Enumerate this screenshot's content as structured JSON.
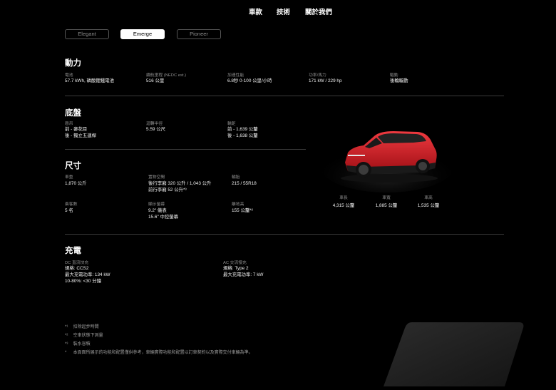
{
  "nav": {
    "items": [
      {
        "label": "車款"
      },
      {
        "label": "技術"
      },
      {
        "label": "關於我們"
      }
    ]
  },
  "trims": {
    "options": [
      {
        "label": "Elegant"
      },
      {
        "label": "Emerge"
      },
      {
        "label": "Pioneer"
      }
    ],
    "selected": "Emerge"
  },
  "power": {
    "title": "動力",
    "specs": [
      {
        "label": "電池",
        "value": "57.7 kWh, 磷酸鋰鐵電池"
      },
      {
        "label": "續航里程 (NEDC est.)",
        "value": "516 公里"
      },
      {
        "label": "加速性能",
        "value": "6.8秒 0-100 公里/小時"
      },
      {
        "label": "功率/馬力",
        "value": "171 kW / 229 hp"
      },
      {
        "label": "驅動",
        "value": "後輪驅動"
      }
    ]
  },
  "chassis": {
    "title": "底盤",
    "specs": [
      {
        "label": "懸吊",
        "value": "前 - 麥花臣\n後 - 獨立五連桿"
      },
      {
        "label": "迴轉半徑",
        "value": "5.59 公尺"
      },
      {
        "label": "輪距",
        "value": "前 - 1,639 公釐\n後 - 1,638 公釐"
      }
    ]
  },
  "dimensions": {
    "title": "尺寸",
    "specs": [
      {
        "label": "車重",
        "value": "1,870 公斤"
      },
      {
        "label": "置物空間",
        "value": "後行李廂 320 公升 / 1,043 公升\n前行李廂 52 公升*³"
      },
      {
        "label": "輪胎",
        "value": "215 / 55R18"
      },
      {
        "label": "乘客數",
        "value": "5 名"
      },
      {
        "label": "顯示螢幕",
        "value": "9.2\" 儀表\n15.6\" 中控螢幕"
      },
      {
        "label": "離地高",
        "value": "155 公釐*²"
      }
    ],
    "car_dims": [
      {
        "label": "車長",
        "value": "4,315 公釐"
      },
      {
        "label": "車寬",
        "value": "1,885 公釐"
      },
      {
        "label": "車高",
        "value": "1,535 公釐"
      }
    ]
  },
  "charging": {
    "title": "充電",
    "specs": [
      {
        "label": "DC 直流快充",
        "value": "規格: CCS2\n最大充電功率: 134 kW\n10-80%: <30 分鐘"
      },
      {
        "label": "AC 交流慢充",
        "value": "規格: Type 2\n最大充電功率: 7 kW"
      }
    ]
  },
  "footnotes": [
    {
      "mark": "*¹",
      "text": "扣除起步時間"
    },
    {
      "mark": "*²",
      "text": "空車狀態下測量"
    },
    {
      "mark": "*³",
      "text": "裝水容積"
    },
    {
      "mark": "*",
      "text": "本頁面所展示的功能和配置僅供參考，車輛實際功能和配置以訂車契約以及實際交付車輛為準。"
    }
  ],
  "colors": {
    "background": "#000000",
    "car_body": "#d4161d",
    "active_tab": "#ffffff"
  }
}
